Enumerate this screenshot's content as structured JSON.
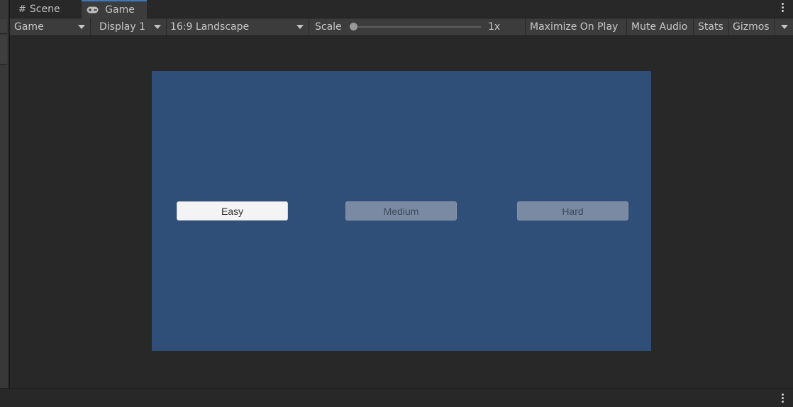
{
  "tabs": [
    {
      "label": "Scene",
      "icon": "grid-icon"
    },
    {
      "label": "Game",
      "icon": "gamepad-icon"
    }
  ],
  "toolbar": {
    "view_mode": "Game",
    "display": "Display 1",
    "aspect": "16:9 Landscape",
    "scale_label": "Scale",
    "scale_value": "1x",
    "scale_fraction": 0,
    "maximize_label": "Maximize On Play",
    "mute_label": "Mute Audio",
    "stats_label": "Stats",
    "gizmos_label": "Gizmos"
  },
  "game": {
    "background": "#2f4e78",
    "buttons": [
      {
        "label": "Easy",
        "state": "active"
      },
      {
        "label": "Medium",
        "state": "disabled"
      },
      {
        "label": "Hard",
        "state": "disabled"
      }
    ]
  },
  "colors": {
    "accent": "#3a79bb",
    "editor_bg": "#282828",
    "toolbar_bg": "#3c3c3c"
  }
}
